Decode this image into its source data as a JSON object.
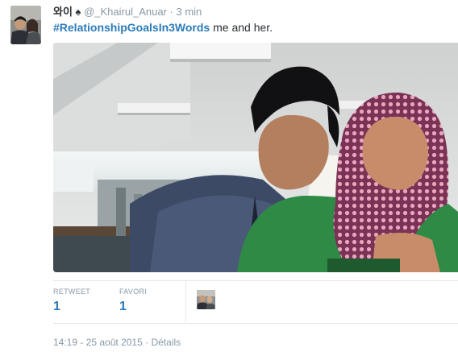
{
  "tweet": {
    "display_name": "와이",
    "badge_symbol": "♠",
    "handle": "@_Khairul_Anuar",
    "time_separator": "·",
    "time_ago": "3 min",
    "hashtag": "#RelationshipGoalsIn3Words",
    "text": " me and her."
  },
  "stats": {
    "retweets_label": "RETWEET",
    "retweets_count": "1",
    "favorites_label": "FAVORI",
    "favorites_count": "1"
  },
  "footer": {
    "timestamp": "14:19 - 25 août 2015",
    "separator": " · ",
    "details_label": "Détails"
  },
  "colors": {
    "link": "#2b7bb9",
    "muted": "#8899a6",
    "text": "#292f33",
    "divider": "#e1e8ed"
  }
}
